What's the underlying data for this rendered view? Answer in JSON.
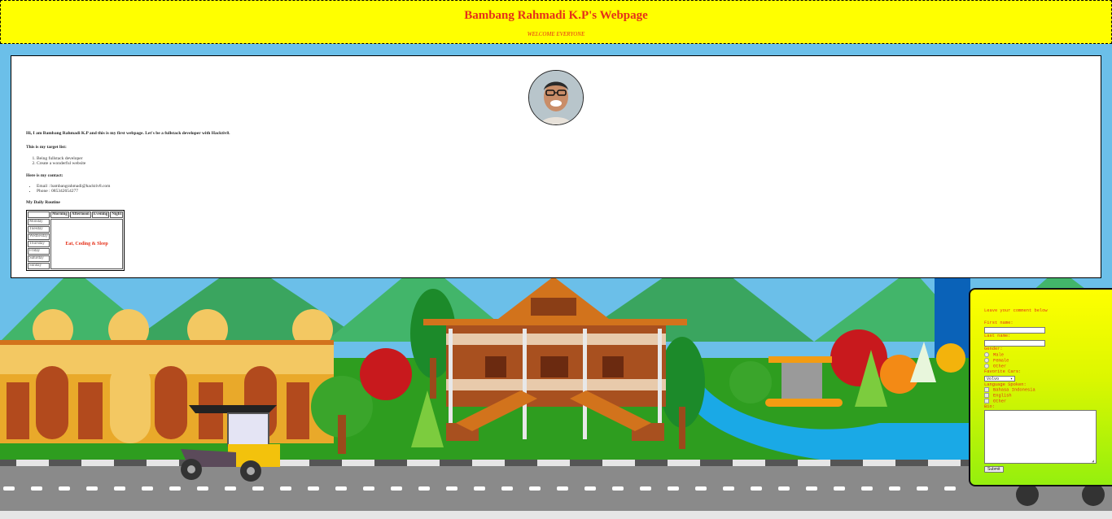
{
  "header": {
    "title": "Bambang Rahmadi K.P's Webpage",
    "subtitle": "WELCOME EVERYONE"
  },
  "profile": {
    "intro": "Hi, I am Bambang Rahmadi K.P and this is my first webpage. Let's be a fullstack developer with Hacktiv8.",
    "target_heading": "This is my target list:",
    "targets": [
      "Being fullstack developer",
      "Create a wonderful website"
    ],
    "contact_heading": "Here is my contact:",
    "contacts": [
      "Email : bambangrahmadi@hacktiv8.com",
      "Phone : 085342654277"
    ],
    "routine_heading": "My Daily Routine"
  },
  "routine_table": {
    "columns": [
      "",
      "Morning",
      "Afternoon",
      "Evening",
      "Night"
    ],
    "days": [
      "Monday",
      "Tuesday",
      "Wednesday",
      "Thursday",
      "Friday",
      "Saturday",
      "Sunday"
    ],
    "activity": "Eat, Coding & Sleep"
  },
  "comment_form": {
    "title": "Leave your comment below",
    "first_name_label": "First name:",
    "last_name_label": "Last name:",
    "gender_label": "Gender:",
    "gender_options": [
      "Male",
      "Female",
      "Other"
    ],
    "car_label": "Favorite Cars:",
    "car_selected": "Volvo",
    "language_label": "Language Spoken:",
    "language_options": [
      "Bahasa Indonesia",
      "English",
      "Other"
    ],
    "bio_label": "Bio:",
    "submit_label": "Submit"
  },
  "colors": {
    "header_bg": "#ffff00",
    "accent_red": "#e53019",
    "sky": "#6bbfe9"
  }
}
